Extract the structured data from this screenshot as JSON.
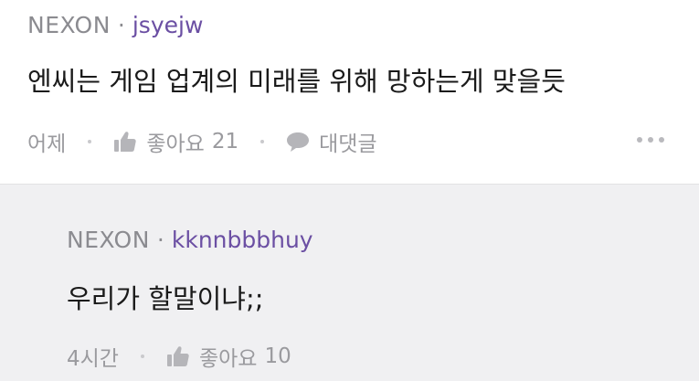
{
  "comment": {
    "company": "NEXON",
    "separator": "·",
    "username": "jsyejw",
    "text": "엔씨는 게임 업계의 미래를 위해 망하는게 맞을듯",
    "time": "어제",
    "like_label": "좋아요",
    "like_count": "21",
    "reply_label": "대댓글",
    "like_icon": "thumbs-up-icon",
    "reply_icon": "speech-bubble-icon",
    "more_icon": "more-dots-icon"
  },
  "reply": {
    "company": "NEXON",
    "separator": "·",
    "username": "kknnbbbhuy",
    "text": "우리가 할말이냐;;",
    "time": "4시간",
    "like_label": "좋아요",
    "like_count": "10",
    "like_icon": "thumbs-up-icon"
  },
  "colors": {
    "username": "#6b4fa3",
    "meta": "#8b8b90",
    "reply_bg": "#f0f0f2"
  }
}
